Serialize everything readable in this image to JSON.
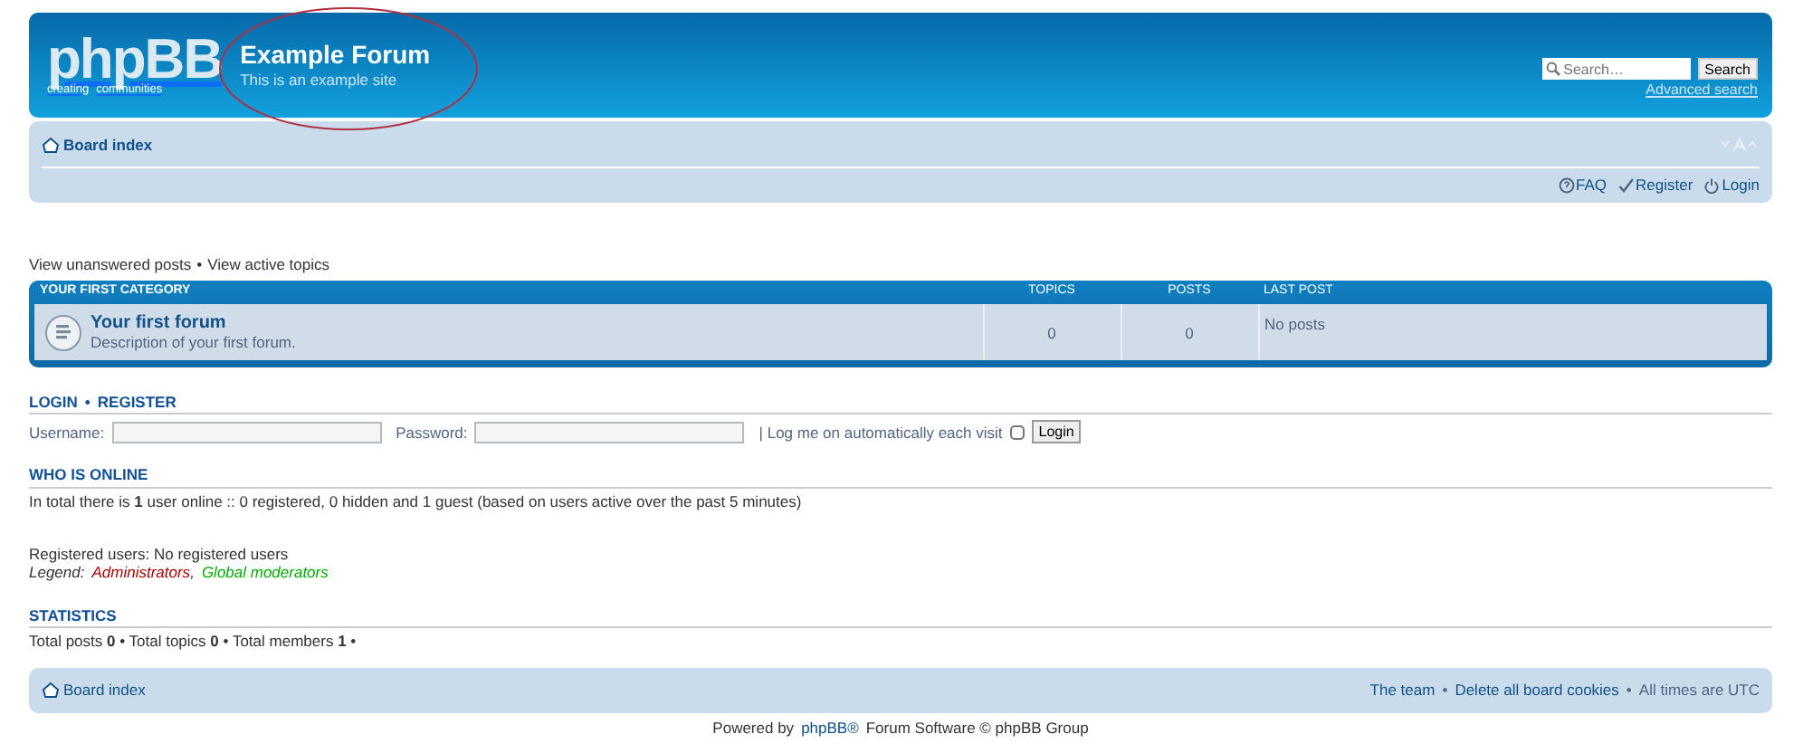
{
  "header": {
    "logo_text": "phpBB",
    "logo_tagline": [
      "creating",
      "communities"
    ],
    "title": "Example Forum",
    "description": "This is an example site",
    "search": {
      "placeholder": "Search…",
      "button": "Search"
    },
    "advanced_search": "Advanced search"
  },
  "navbar": {
    "breadcrumb": "Board index",
    "links": [
      {
        "kind": "faq",
        "label": "FAQ"
      },
      {
        "kind": "register",
        "label": "Register"
      },
      {
        "kind": "login",
        "label": "Login"
      }
    ]
  },
  "quick_links": {
    "items": [
      "View unanswered posts",
      "View active topics"
    ],
    "separator": "•"
  },
  "forum_table": {
    "columns": [
      "YOUR FIRST CATEGORY",
      "TOPICS",
      "POSTS",
      "LAST POST"
    ],
    "rows": [
      {
        "name": "Your first forum",
        "description": "Description of your first forum.",
        "topics": "0",
        "posts": "0",
        "last_post": "No posts"
      }
    ]
  },
  "login": {
    "heading": [
      "LOGIN",
      "REGISTER"
    ],
    "separator": "•",
    "username_label": "Username:",
    "password_label": "Password:",
    "remember_label": "| Log me on automatically each visit",
    "remember_checked": false,
    "button": "Login"
  },
  "who_is_online": {
    "heading": "WHO IS ONLINE",
    "summary": "In total there is **1** user online :: 0 registered, 0 hidden and 1 guest (based on users active over the past 5 minutes)",
    "registered": "Registered users: No registered users",
    "legend_label": "Legend:",
    "group_separator": ",",
    "groups": [
      {
        "name": "Administrators",
        "color": "#aa0000"
      },
      {
        "name": "Global moderators",
        "color": "#00aa00"
      }
    ]
  },
  "statistics": {
    "heading": "STATISTICS",
    "text": "Total posts **0** • Total topics **0** • Total members **1** •"
  },
  "footer": {
    "breadcrumb": "Board index",
    "links": [
      "The team",
      "Delete all board cookies"
    ],
    "separator": "•",
    "timezone": "All times are UTC"
  },
  "powered": {
    "prefix": "Powered by",
    "link": "phpBB®",
    "suffix": "Forum Software © phpBB Group"
  }
}
